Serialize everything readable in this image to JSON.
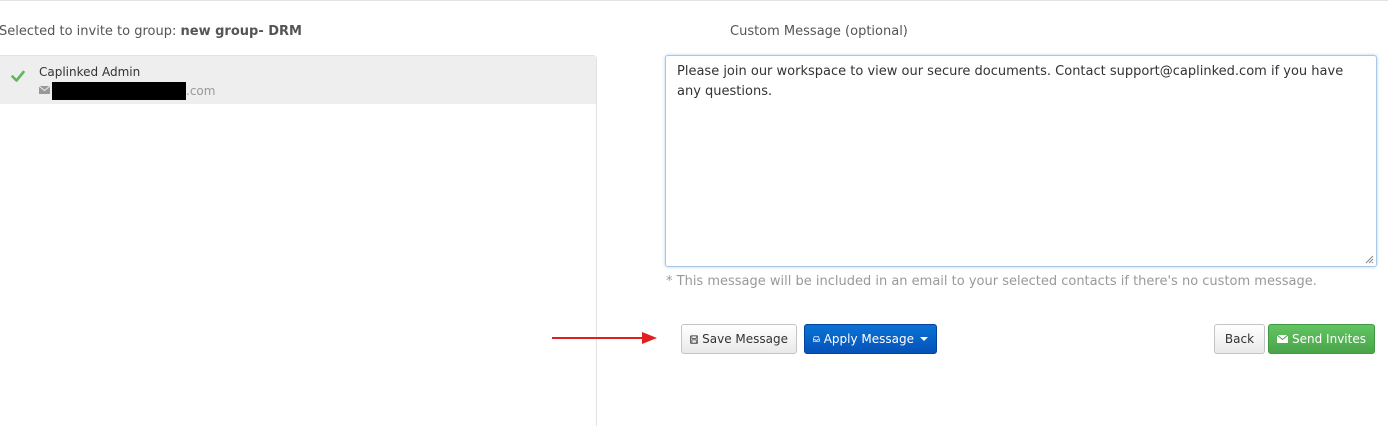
{
  "invite": {
    "selected_prefix": "Selected to invite to group: ",
    "group_name": "new group- DRM"
  },
  "contacts": [
    {
      "name": "Caplinked Admin",
      "email_domain": ".com",
      "selected": true
    }
  ],
  "message": {
    "label": "Custom Message (optional)",
    "text": "Please join our workspace to view our secure documents. Contact support@caplinked.com if you have any questions.",
    "help": "* This message will be included in an email to your selected contacts if there's no custom message."
  },
  "buttons": {
    "save": "Save Message",
    "apply": "Apply Message",
    "back": "Back",
    "send": "Send Invites"
  },
  "icons": {
    "check": "check-icon",
    "envelope": "envelope-icon",
    "save": "floppy-disk-icon",
    "apply": "inbox-icon",
    "send": "envelope-icon",
    "arrow": "red-arrow-right"
  },
  "colors": {
    "primary": "#0652b8",
    "success": "#4aa44a",
    "check": "#5cb85c",
    "annotation_arrow": "#e02020"
  }
}
